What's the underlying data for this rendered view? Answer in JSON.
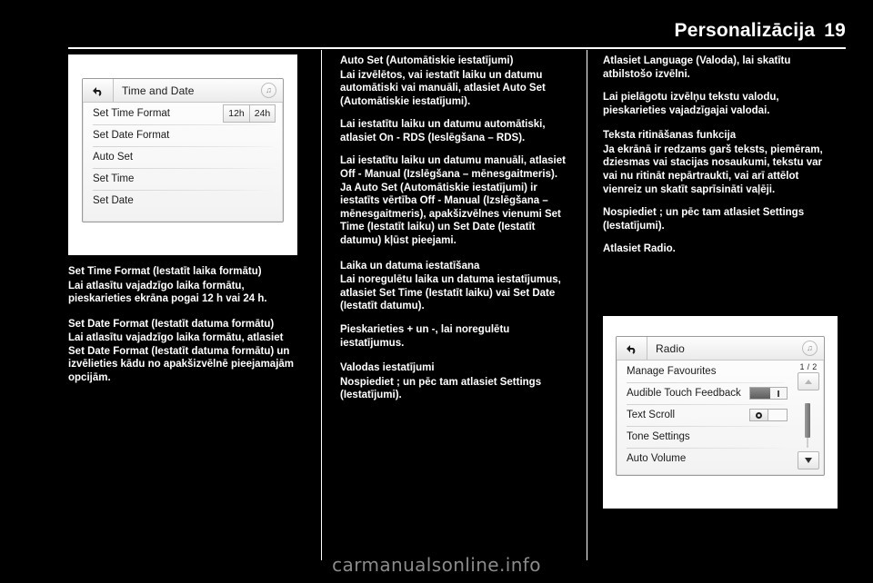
{
  "header": {
    "title": "Personalizācija",
    "page_number": "19"
  },
  "time_date_screen": {
    "back_icon": "back-arrow-icon",
    "title": "Time and Date",
    "note_icon": "music-note-icon",
    "rows": [
      {
        "label": "Set Time Format",
        "control": "segmented"
      },
      {
        "label": "Set Date Format",
        "control": "none"
      },
      {
        "label": "Auto Set",
        "control": "none"
      },
      {
        "label": "Set Time",
        "control": "none"
      },
      {
        "label": "Set Date",
        "control": "none"
      }
    ],
    "time_format_options": [
      "12h",
      "24h"
    ]
  },
  "radio_screen": {
    "back_icon": "back-arrow-icon",
    "title": "Radio",
    "note_icon": "music-note-icon",
    "page_indicator": "1 / 2",
    "scroll_up_icon": "triangle-up-icon",
    "scroll_down_icon": "triangle-down-icon",
    "rows": [
      {
        "label": "Manage Favourites",
        "control": "none"
      },
      {
        "label": "Audible Touch Feedback",
        "control": "slider-toggle"
      },
      {
        "label": "Text Scroll",
        "control": "circle-toggle"
      },
      {
        "label": "Tone Settings",
        "control": "none"
      },
      {
        "label": "Auto Volume",
        "control": "none"
      }
    ]
  },
  "column_left": [
    {
      "type": "heading",
      "text": "Set Time Format (Iestatīt laika formātu)"
    },
    {
      "type": "para",
      "text": "Lai atlasītu vajadzīgo laika formātu, pieskarieties ekrāna pogai 12 h vai 24 h."
    },
    {
      "type": "heading",
      "text": "Set Date Format (Iestatīt datuma formātu)"
    },
    {
      "type": "para",
      "text": "Lai atlasītu vajadzīgo laika formātu, atlasiet Set Date Format (Iestatīt datuma formātu) un izvēlieties kādu no apakšizvēlnē pieejamajām opcijām."
    }
  ],
  "column_mid": [
    {
      "type": "heading",
      "text": "Auto Set (Automātiskie iestatījumi)"
    },
    {
      "type": "para",
      "text": "Lai izvēlētos, vai iestatīt laiku un datumu automātiski vai manuāli, atlasiet Auto Set (Automātiskie iestatījumi)."
    },
    {
      "type": "para",
      "text": "Lai iestatītu laiku un datumu automātiski, atlasiet On - RDS (Ieslēgšana – RDS)."
    },
    {
      "type": "para",
      "text": "Lai iestatītu laiku un datumu manuāli, atlasiet Off - Manual (Izslēgšana – mēnesgaitmeris). Ja Auto Set (Automātiskie iestatījumi) ir iestatīts vērtība Off - Manual (Izslēgšana – mēnesgaitmeris), apakšizvēlnes vienumi Set Time (Iestatīt laiku) un Set Date (Iestatīt datumu) kļūst pieejami."
    },
    {
      "type": "heading",
      "text": "Laika un datuma iestatīšana"
    },
    {
      "type": "para",
      "text": "Lai noregulētu laika un datuma iestatījumus, atlasiet Set Time (Iestatīt laiku) vai Set Date (Iestatīt datumu)."
    },
    {
      "type": "para",
      "text": "Pieskarieties + un -, lai noregulētu iestatījumus."
    },
    {
      "type": "heading",
      "text": "Valodas iestatījumi"
    },
    {
      "type": "para",
      "text": "Nospiediet ; un pēc tam atlasiet Settings (Iestatījumi)."
    }
  ],
  "column_right": [
    {
      "type": "para",
      "text": "Atlasiet Language (Valoda), lai skatītu atbilstošo izvēlni."
    },
    {
      "type": "para",
      "text": "Lai pielāgotu izvēlņu tekstu valodu, pieskarieties vajadzīgajai valodai."
    },
    {
      "type": "heading",
      "text": "Teksta ritināšanas funkcija"
    },
    {
      "type": "para",
      "text": "Ja ekrānā ir redzams garš teksts, piemēram, dziesmas vai stacijas nosaukumi, tekstu var vai nu ritināt nepārtraukti, vai arī attēlot vienreiz un skatīt saprīsināti vaļēji."
    },
    {
      "type": "para",
      "text": "Nospiediet ; un pēc tam atlasiet Settings (Iestatījumi)."
    },
    {
      "type": "para",
      "text": "Atlasiet Radio."
    }
  ],
  "watermark": "carmanualsonline.info"
}
